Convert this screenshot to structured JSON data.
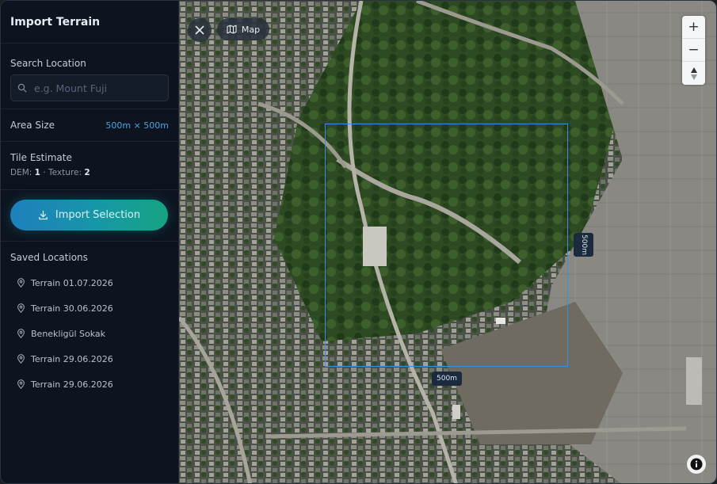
{
  "sidebar": {
    "title": "Import Terrain",
    "search": {
      "label": "Search Location",
      "placeholder": "e.g. Mount Fuji",
      "value": ""
    },
    "area": {
      "label": "Area Size",
      "value": "500m × 500m"
    },
    "tiles": {
      "label": "Tile Estimate",
      "dem_label": "DEM:",
      "dem_value": "1",
      "separator": "·",
      "texture_label": "Texture:",
      "texture_value": "2"
    },
    "import_button": {
      "label": "Import Selection",
      "icon": "download-icon"
    },
    "saved": {
      "label": "Saved Locations",
      "items": [
        {
          "label": "Terrain 01.07.2026"
        },
        {
          "label": "Terrain 30.06.2026"
        },
        {
          "label": "Benekligül Sokak"
        },
        {
          "label": "Terrain 29.06.2026"
        },
        {
          "label": "Terrain 29.06.2026"
        }
      ]
    }
  },
  "map": {
    "close_icon": "close-icon",
    "map_button": {
      "label": "Map",
      "icon": "map-icon"
    },
    "zoom": {
      "in_label": "+",
      "out_label": "−",
      "compass_icon": "compass-icon"
    },
    "selection": {
      "width_label": "500m",
      "height_label": "500m"
    },
    "info_icon": "info-icon"
  },
  "colors": {
    "accent": "#4aa3df",
    "selection": "#3b8ee0",
    "sidebar_bg": "#0d1420",
    "button_start": "#1f7fbd",
    "button_end": "#15a480"
  }
}
